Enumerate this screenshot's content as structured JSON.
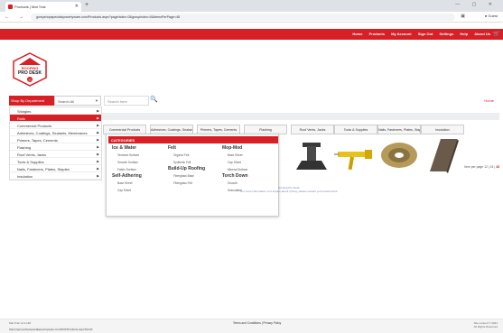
{
  "browser": {
    "tab_title": "Products | Mat Trak",
    "url": "gomyshopspecialspovertyware.com/Products.aspx?pageIndex=0&groupIndex=0&itemsPerPage=48",
    "profile_label": "Guest"
  },
  "topnav": {
    "links": [
      "Home",
      "Products",
      "My Account",
      "Sign Out",
      "Settings",
      "Help",
      "About Us"
    ]
  },
  "logo": {
    "line1": "ROOFING",
    "line2": "PRO DESK",
    "badge": "22"
  },
  "search": {
    "shop_dept": "Shop By Department",
    "search_all": "Search All",
    "placeholder": "Search here",
    "home_link": "Home"
  },
  "sidebar": {
    "items": [
      {
        "label": "Shingles",
        "active": false
      },
      {
        "label": "Rolls",
        "active": true
      },
      {
        "label": "Commercial Products",
        "active": false
      },
      {
        "label": "Adhesives, Coatings, Sealants, Membranes",
        "active": false
      },
      {
        "label": "Primers, Tapes, Cements",
        "active": false
      },
      {
        "label": "Flashing",
        "active": false
      },
      {
        "label": "Roof Vents, Jacks",
        "active": false
      },
      {
        "label": "Tools & Supplies",
        "active": false
      },
      {
        "label": "Nails, Fasteners, Plates, Staples",
        "active": false
      },
      {
        "label": "Insulation",
        "active": false
      }
    ]
  },
  "category_tabs": [
    "Commercial Products",
    "Adhesives, Coatings, Sealants, Membranes",
    "Primers, Tapes, Cements",
    "Flashing",
    "Roof Vents, Jacks",
    "Tools & Supplies",
    "Nails, Fasteners, Plates, Staples",
    "Insulation"
  ],
  "mega": {
    "header": "CATEGORIES",
    "columns": [
      {
        "sections": [
          {
            "title": "Ice & Water",
            "items": [
              "Textured Surface",
              "Smooth Surface",
              "Fabric Surface"
            ]
          },
          {
            "title": "Self-Adhering",
            "items": [
              "Base Sheet",
              "Cap Sheet"
            ]
          }
        ]
      },
      {
        "sections": [
          {
            "title": "Felt",
            "items": [
              "Organic Felt",
              "Synthetic Felt"
            ]
          },
          {
            "title": "Build-Up Roofing",
            "items": [
              "Fiberglass Base",
              "Fiberglass Felt"
            ]
          }
        ]
      },
      {
        "sections": [
          {
            "title": "Mop-Mod",
            "items": [
              "Base Sheet",
              "Cap Sheet",
              "Mineral Surface"
            ]
          },
          {
            "title": "Torch Down",
            "items": [
              "Smooth",
              "Granulated"
            ]
          }
        ]
      }
    ]
  },
  "pager": {
    "label": "Item per page",
    "options": [
      "12",
      "24",
      "48"
    ]
  },
  "notice": {
    "line1": "Roofing Pro Desk",
    "line2": "For more information or to inquire about pricing, please contact your local branch"
  },
  "footer": {
    "left": "Mat Trak v2.2.148",
    "center": "Terms and Conditions | Privacy Policy",
    "right_line1": "Site content © 2021",
    "right_line2": "All Rights Reserved",
    "status_url": "https://gomyshopspecialspovertyware.com/#/AT/Products.aspx?id=23"
  },
  "colors": {
    "brand_red": "#d71f26"
  }
}
